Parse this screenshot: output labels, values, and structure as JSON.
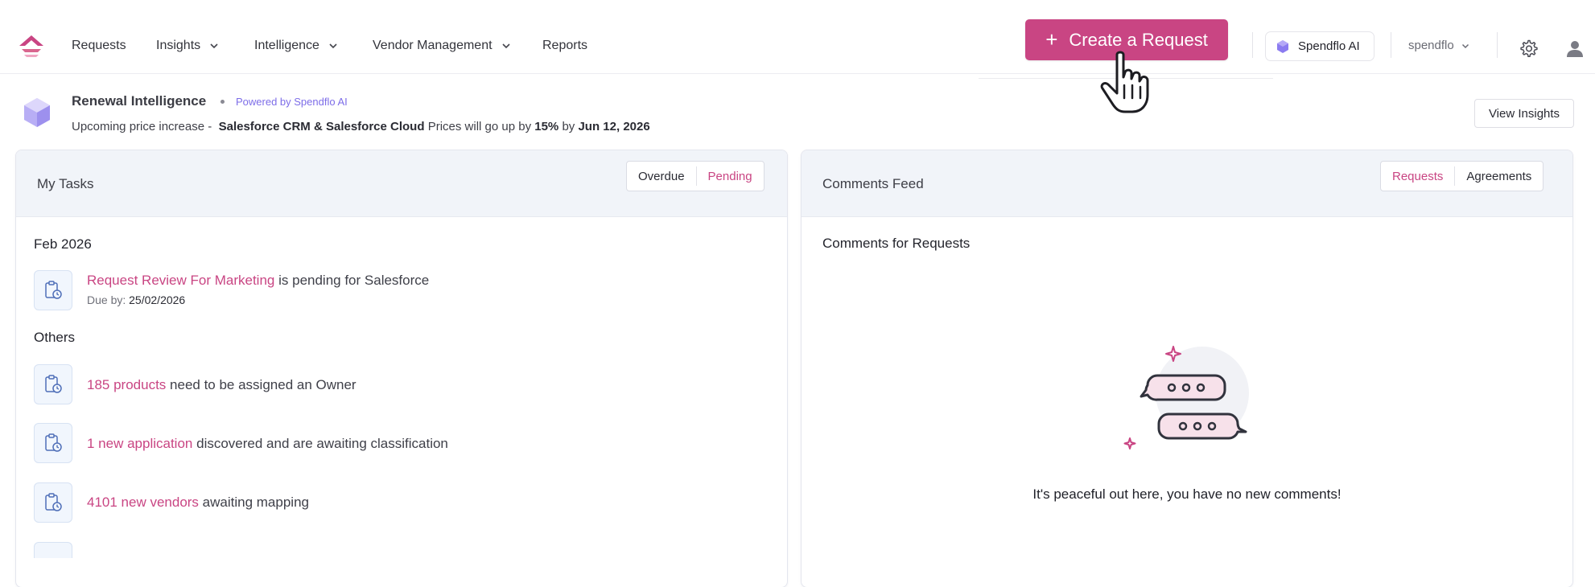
{
  "nav": {
    "items": [
      {
        "label": "Requests",
        "has_menu": false
      },
      {
        "label": "Insights",
        "has_menu": true
      },
      {
        "label": "Intelligence",
        "has_menu": true
      },
      {
        "label": "Vendor Management",
        "has_menu": true
      },
      {
        "label": "Reports",
        "has_menu": false
      }
    ],
    "create_button": "Create a Request",
    "ai_button": "Spendflo AI",
    "account": "spendflo"
  },
  "banner": {
    "title": "Renewal Intelligence",
    "powered": "Powered by Spendflo AI",
    "prefix": "Upcoming price increase -",
    "products": "Salesforce CRM & Salesforce Cloud",
    "middle": "Prices will go up by",
    "percent": "15%",
    "by": "by",
    "date": "Jun 12, 2026",
    "view_button": "View Insights"
  },
  "tasks": {
    "title": "My Tasks",
    "toggle": [
      {
        "label": "Overdue",
        "selected": false
      },
      {
        "label": "Pending",
        "selected": true
      }
    ],
    "group1": "Feb 2026",
    "item1_link": "Request Review For Marketing",
    "item1_text": "is pending for Salesforce",
    "item1_due_label": "Due by:",
    "item1_due": "25/02/2026",
    "group2": "Others",
    "item2_link": "185 products",
    "item2_text": "need to be assigned an Owner",
    "item3_link": "1 new application",
    "item3_text": "discovered and are awaiting classification",
    "item4_link": "4101 new vendors",
    "item4_text": "awaiting mapping"
  },
  "comments": {
    "title": "Comments Feed",
    "toggle": [
      {
        "label": "Requests",
        "selected": true
      },
      {
        "label": "Agreements",
        "selected": false
      }
    ],
    "subtitle": "Comments for Requests",
    "empty_message": "It's peaceful out here, you have no new comments!"
  },
  "colors": {
    "accent": "#c94583",
    "ai_purple": "#7d6de8",
    "panel_header": "#f1f4f9"
  }
}
